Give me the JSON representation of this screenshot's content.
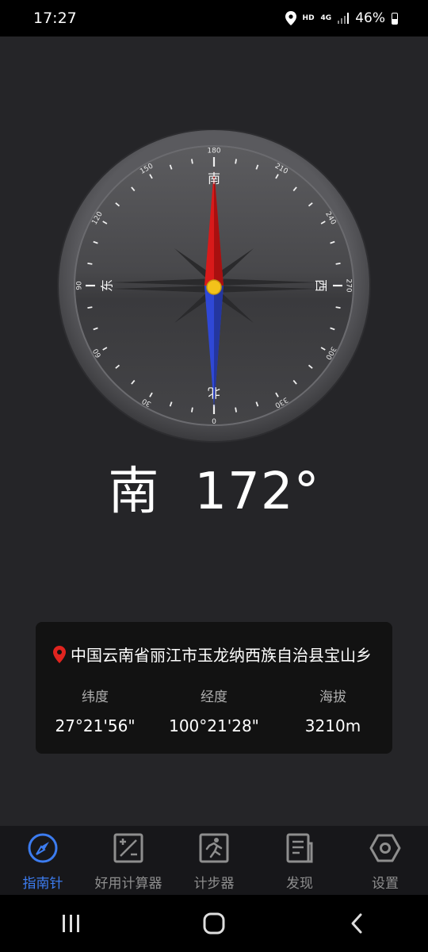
{
  "status_bar": {
    "time": "17:27",
    "hd": "HD",
    "net": "4G",
    "battery": "46%"
  },
  "compass": {
    "direction": "南",
    "degrees": "172°",
    "cardinals": {
      "top": "南",
      "right": "西",
      "bottom": "北",
      "left": "东"
    },
    "tick_labels": [
      "180",
      "210",
      "240",
      "270",
      "300",
      "330",
      "0",
      "30",
      "60",
      "90",
      "120",
      "150"
    ],
    "needle_colors": {
      "north": "#d91a1a",
      "south": "#2f48d6",
      "hub": "#f3c21a"
    }
  },
  "location": {
    "address": "中国云南省丽江市玉龙纳西族自治县宝山乡",
    "latitude_label": "纬度",
    "latitude": "27°21'56\"",
    "longitude_label": "经度",
    "longitude": "100°21'28\"",
    "altitude_label": "海拔",
    "altitude": "3210m"
  },
  "nav": {
    "items": [
      {
        "label": "指南针",
        "icon": "compass-icon",
        "active": true
      },
      {
        "label": "好用计算器",
        "icon": "calculator-icon",
        "active": false
      },
      {
        "label": "计步器",
        "icon": "runner-icon",
        "active": false
      },
      {
        "label": "发现",
        "icon": "document-icon",
        "active": false
      },
      {
        "label": "设置",
        "icon": "settings-hexagon-icon",
        "active": false
      }
    ]
  },
  "colors": {
    "accent": "#3c7cf0",
    "background": "#252528",
    "card": "#121212"
  }
}
